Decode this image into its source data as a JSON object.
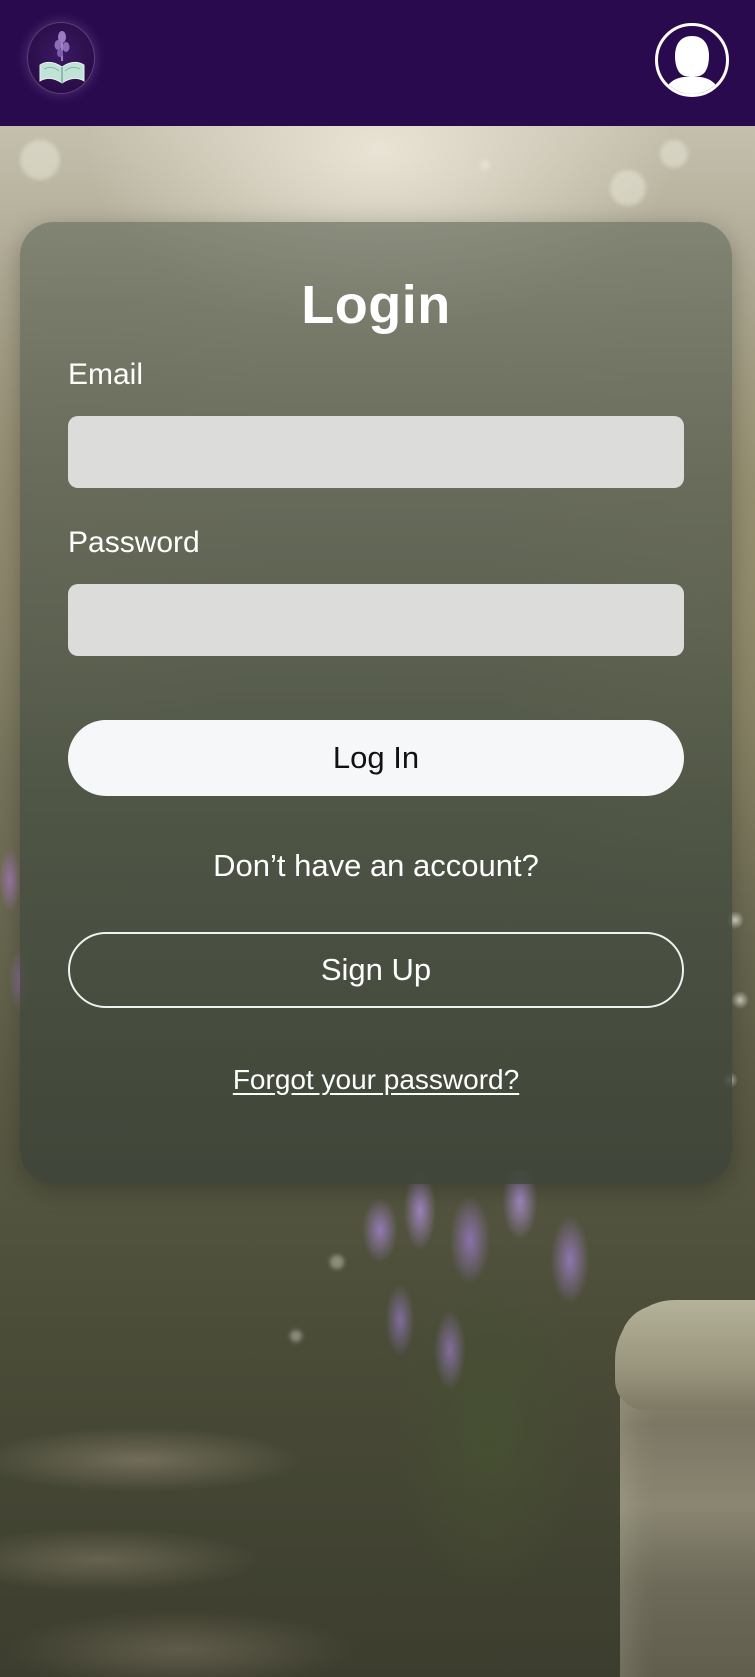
{
  "header": {
    "logo_icon": "book-flower-logo-icon",
    "profile_icon": "user-avatar-icon",
    "background_color": "#2a0a4f"
  },
  "login": {
    "title": "Login",
    "email_label": "Email",
    "email_value": "",
    "password_label": "Password",
    "password_value": "",
    "login_button": "Log In",
    "signup_prompt": "Don’t have an account?",
    "signup_button": "Sign Up",
    "forgot_link": "Forgot your password?"
  },
  "background": {
    "description_icon": "garden-background"
  }
}
